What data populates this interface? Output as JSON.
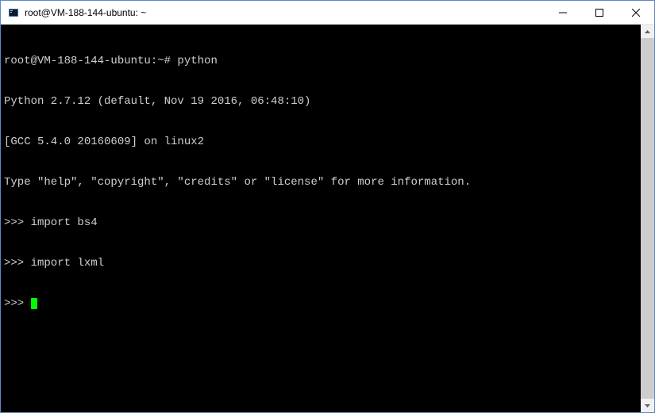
{
  "window": {
    "title": "root@VM-188-144-ubuntu: ~"
  },
  "terminal": {
    "lines": [
      "root@VM-188-144-ubuntu:~# python",
      "Python 2.7.12 (default, Nov 19 2016, 06:48:10)",
      "[GCC 5.4.0 20160609] on linux2",
      "Type \"help\", \"copyright\", \"credits\" or \"license\" for more information.",
      ">>> import bs4",
      ">>> import lxml"
    ],
    "prompt": ">>> "
  }
}
